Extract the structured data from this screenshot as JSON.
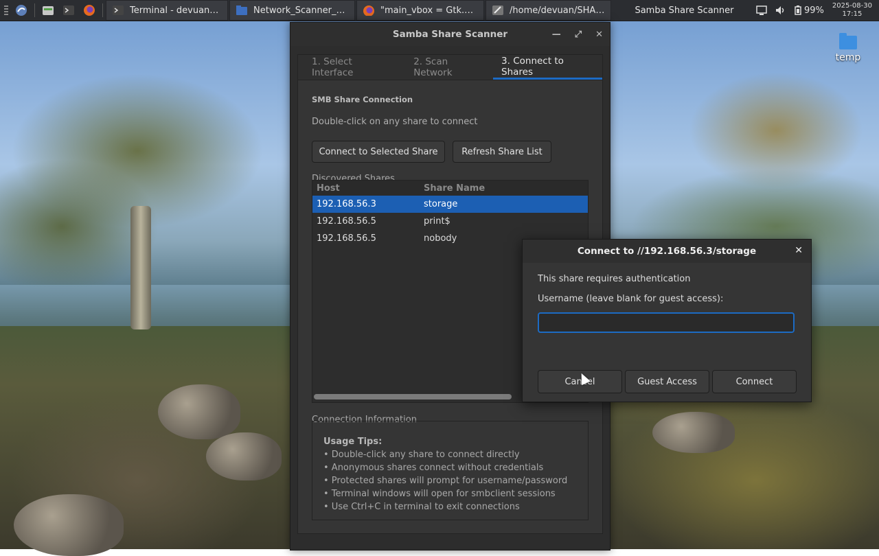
{
  "taskbar": {
    "tasks": [
      {
        "label": "Terminal - devuan@d...",
        "icon": "terminal-icon"
      },
      {
        "label": "Network_Scanner_To...",
        "icon": "folder-icon"
      },
      {
        "label": "\"main_vbox = Gtk.VBo...",
        "icon": "firefox-icon"
      },
      {
        "label": "/home/devuan/SHAR...",
        "icon": "editor-icon"
      }
    ],
    "active_title": "Samba Share Scanner",
    "battery": "99%",
    "date": "2025-08-30",
    "time": "17:15"
  },
  "desktop": {
    "icon_label": "temp"
  },
  "window": {
    "title": "Samba Share Scanner",
    "tabs": [
      "1. Select Interface",
      "2. Scan Network",
      "3. Connect to Shares"
    ],
    "section_title": "SMB Share Connection",
    "hint": "Double-click on any share to connect",
    "connect_button": "Connect to Selected Share",
    "refresh_button": "Refresh Share List",
    "shares_frame_label": "Discovered Shares",
    "columns": [
      "Host",
      "Share Name"
    ],
    "shares": [
      {
        "host": "192.168.56.3",
        "share": "storage"
      },
      {
        "host": "192.168.56.5",
        "share": "print$"
      },
      {
        "host": "192.168.56.5",
        "share": "nobody"
      }
    ],
    "info_frame_label": "Connection Information",
    "tips_title": "Usage Tips:",
    "tips": [
      "• Double-click any share to connect directly",
      "• Anonymous shares connect without credentials",
      "• Protected shares will prompt for username/password",
      "• Terminal windows will open for smbclient sessions",
      "• Use Ctrl+C in terminal to exit connections"
    ]
  },
  "dialog": {
    "title": "Connect to //192.168.56.3/storage",
    "message": "This share requires authentication",
    "username_label": "Username (leave blank for guest access):",
    "username_value": "",
    "cancel": "Cancel",
    "guest": "Guest Access",
    "connect": "Connect"
  },
  "colors": {
    "accent": "#1c6bc4",
    "selection": "#1c5fb3",
    "window_bg": "#353535"
  }
}
